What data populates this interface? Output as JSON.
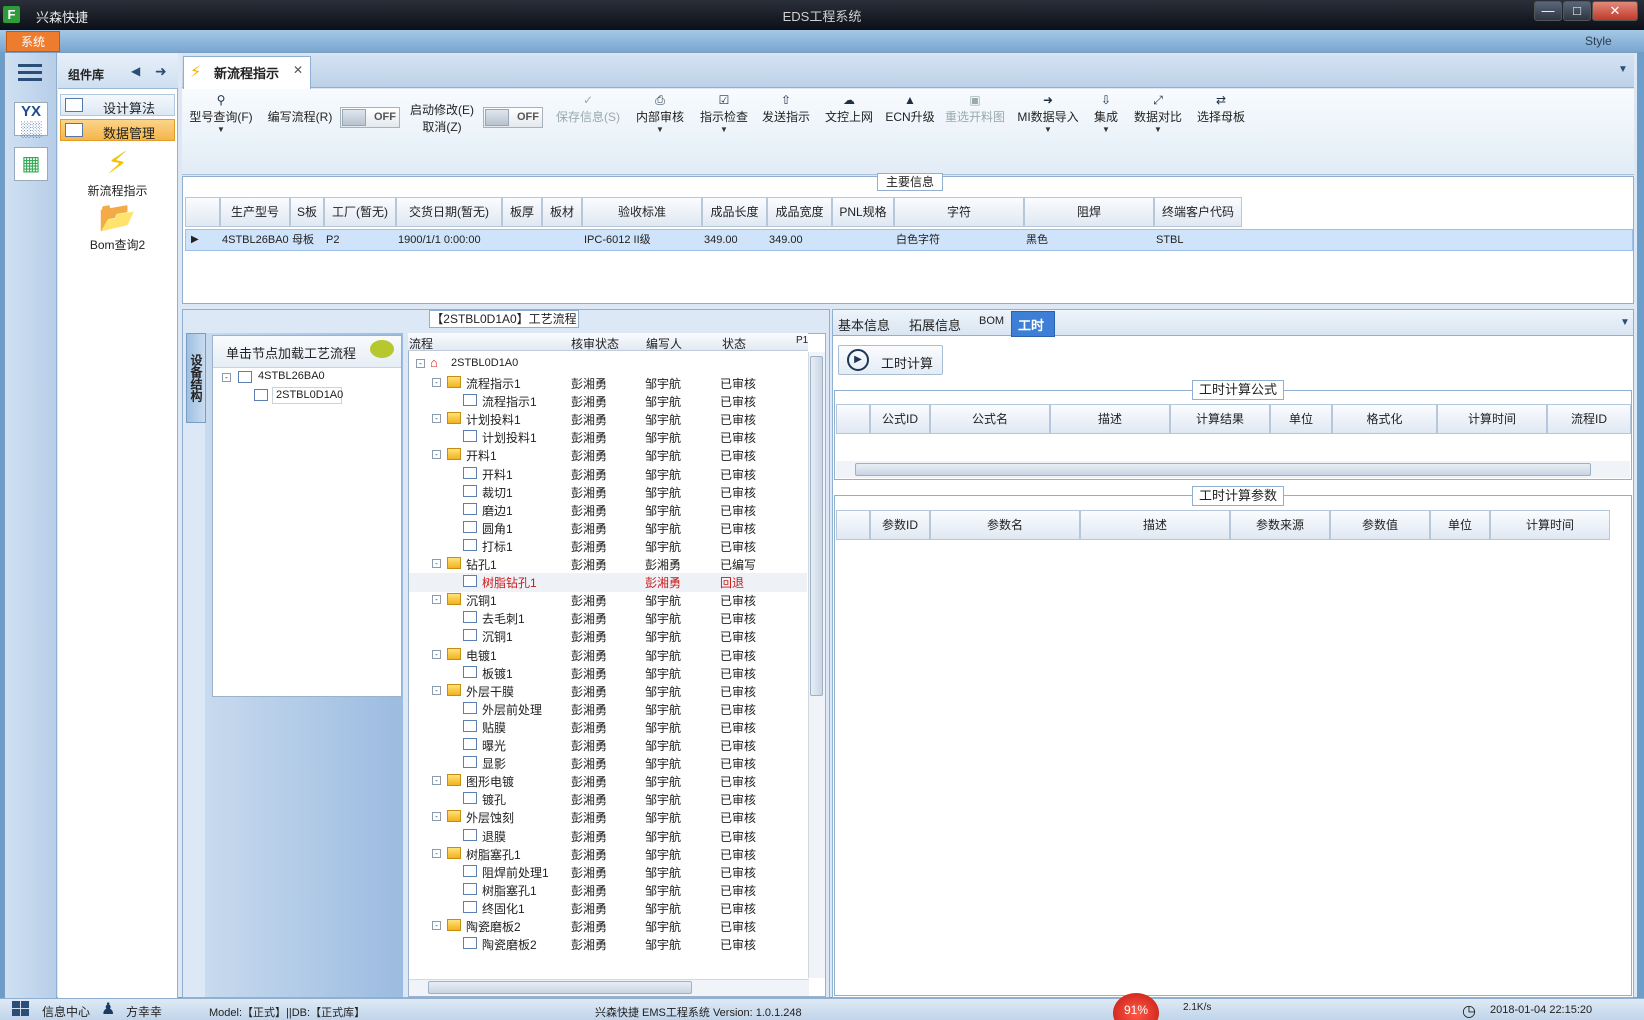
{
  "window": {
    "app_name": "兴森快捷",
    "title": "EDS工程系统",
    "logo": "F",
    "menu_system": "系统",
    "style_label": "Style"
  },
  "library": {
    "title": "组件库",
    "items": [
      "设计算法",
      "数据管理"
    ],
    "tools": [
      {
        "label": "新流程指示",
        "icon": "lightning-icon"
      },
      {
        "label": "Bom查询2",
        "icon": "folder-icon"
      }
    ]
  },
  "tab": {
    "label": "新流程指示"
  },
  "ribbon": {
    "buttons": [
      {
        "label": "型号查询(F)",
        "icon": "search-icon"
      },
      {
        "label": "编写流程(R)",
        "icon": ""
      },
      {
        "label": "启动修改(E)",
        "icon": ""
      },
      {
        "label": "取消(Z)",
        "icon": ""
      },
      {
        "label": "保存信息(S)",
        "icon": "check-icon"
      },
      {
        "label": "内部审核",
        "icon": "print-icon"
      },
      {
        "label": "指示检查",
        "icon": "checkbox-icon"
      },
      {
        "label": "发送指示",
        "icon": "upload-icon"
      },
      {
        "label": "文控上网",
        "icon": "cloud-upload-icon"
      },
      {
        "label": "ECN升级",
        "icon": "road-icon"
      },
      {
        "label": "重选开料图",
        "icon": "image-icon"
      },
      {
        "label": "MI数据导入",
        "icon": "import-icon"
      },
      {
        "label": "集成",
        "icon": "download-icon"
      },
      {
        "label": "数据对比",
        "icon": "compress-icon"
      },
      {
        "label": "选择母板",
        "icon": "shuffle-icon"
      }
    ],
    "toggle_off": "OFF"
  },
  "main_info": {
    "title": "主要信息",
    "columns": [
      "生产型号",
      "S板",
      "工厂(暂无)",
      "交货日期(暂无)",
      "板厚",
      "板材",
      "验收标准",
      "成品长度",
      "成品宽度",
      "PNL规格",
      "字符",
      "阻焊",
      "终端客户代码"
    ],
    "row": [
      "4STBL26BA0",
      "母板",
      "P2",
      "1900/1/1 0:00:00",
      "",
      "",
      "IPC-6012 II级",
      "349.00",
      "349.00",
      "",
      "白色字符",
      "黑色",
      "STBL"
    ]
  },
  "flow": {
    "title": "【2STBL0D1A0】工艺流程",
    "struct_tab": "设备结构",
    "struct_head": "单击节点加载工艺流程",
    "struct_nodes": [
      "4STBL26BA0",
      "2STBL0D1A0"
    ],
    "columns": [
      "流程",
      "核审状态",
      "编写人",
      "状态",
      "P1"
    ],
    "root": "2STBL0D1A0",
    "rows": [
      {
        "name": "流程指示1",
        "type": "folder",
        "reviewer": "彭湘勇",
        "writer": "邹宇航",
        "status": "已审核"
      },
      {
        "name": "流程指示1",
        "type": "doc",
        "reviewer": "彭湘勇",
        "writer": "邹宇航",
        "status": "已审核"
      },
      {
        "name": "计划投料1",
        "type": "folder",
        "reviewer": "彭湘勇",
        "writer": "邹宇航",
        "status": "已审核"
      },
      {
        "name": "计划投料1",
        "type": "doc",
        "reviewer": "彭湘勇",
        "writer": "邹宇航",
        "status": "已审核"
      },
      {
        "name": "开料1",
        "type": "folder",
        "reviewer": "彭湘勇",
        "writer": "邹宇航",
        "status": "已审核"
      },
      {
        "name": "开料1",
        "type": "doc",
        "reviewer": "彭湘勇",
        "writer": "邹宇航",
        "status": "已审核"
      },
      {
        "name": "裁切1",
        "type": "doc",
        "reviewer": "彭湘勇",
        "writer": "邹宇航",
        "status": "已审核"
      },
      {
        "name": "磨边1",
        "type": "doc",
        "reviewer": "彭湘勇",
        "writer": "邹宇航",
        "status": "已审核"
      },
      {
        "name": "圆角1",
        "type": "doc",
        "reviewer": "彭湘勇",
        "writer": "邹宇航",
        "status": "已审核"
      },
      {
        "name": "打标1",
        "type": "doc",
        "reviewer": "彭湘勇",
        "writer": "邹宇航",
        "status": "已审核"
      },
      {
        "name": "钻孔1",
        "type": "folder",
        "reviewer": "彭湘勇",
        "writer": "彭湘勇",
        "status": "已编写"
      },
      {
        "name": "树脂钻孔1",
        "type": "doc",
        "reviewer": "",
        "writer": "彭湘勇",
        "status": "回退",
        "red": true
      },
      {
        "name": "沉铜1",
        "type": "folder",
        "reviewer": "彭湘勇",
        "writer": "邹宇航",
        "status": "已审核"
      },
      {
        "name": "去毛刺1",
        "type": "doc",
        "reviewer": "彭湘勇",
        "writer": "邹宇航",
        "status": "已审核"
      },
      {
        "name": "沉铜1",
        "type": "doc",
        "reviewer": "彭湘勇",
        "writer": "邹宇航",
        "status": "已审核"
      },
      {
        "name": "电镀1",
        "type": "folder",
        "reviewer": "彭湘勇",
        "writer": "邹宇航",
        "status": "已审核"
      },
      {
        "name": "板镀1",
        "type": "doc",
        "reviewer": "彭湘勇",
        "writer": "邹宇航",
        "status": "已审核"
      },
      {
        "name": "外层干膜",
        "type": "folder",
        "reviewer": "彭湘勇",
        "writer": "邹宇航",
        "status": "已审核"
      },
      {
        "name": "外层前处理",
        "type": "doc",
        "reviewer": "彭湘勇",
        "writer": "邹宇航",
        "status": "已审核"
      },
      {
        "name": "贴膜",
        "type": "doc",
        "reviewer": "彭湘勇",
        "writer": "邹宇航",
        "status": "已审核"
      },
      {
        "name": "曝光",
        "type": "doc",
        "reviewer": "彭湘勇",
        "writer": "邹宇航",
        "status": "已审核"
      },
      {
        "name": "显影",
        "type": "doc",
        "reviewer": "彭湘勇",
        "writer": "邹宇航",
        "status": "已审核"
      },
      {
        "name": "图形电镀",
        "type": "folder",
        "reviewer": "彭湘勇",
        "writer": "邹宇航",
        "status": "已审核"
      },
      {
        "name": "镀孔",
        "type": "doc",
        "reviewer": "彭湘勇",
        "writer": "邹宇航",
        "status": "已审核"
      },
      {
        "name": "外层蚀刻",
        "type": "folder",
        "reviewer": "彭湘勇",
        "writer": "邹宇航",
        "status": "已审核"
      },
      {
        "name": "退膜",
        "type": "doc",
        "reviewer": "彭湘勇",
        "writer": "邹宇航",
        "status": "已审核"
      },
      {
        "name": "树脂塞孔1",
        "type": "folder",
        "reviewer": "彭湘勇",
        "writer": "邹宇航",
        "status": "已审核"
      },
      {
        "name": "阻焊前处理1",
        "type": "doc",
        "reviewer": "彭湘勇",
        "writer": "邹宇航",
        "status": "已审核"
      },
      {
        "name": "树脂塞孔1",
        "type": "doc",
        "reviewer": "彭湘勇",
        "writer": "邹宇航",
        "status": "已审核"
      },
      {
        "name": "终固化1",
        "type": "doc",
        "reviewer": "彭湘勇",
        "writer": "邹宇航",
        "status": "已审核"
      },
      {
        "name": "陶瓷磨板2",
        "type": "folder",
        "reviewer": "彭湘勇",
        "writer": "邹宇航",
        "status": "已审核"
      },
      {
        "name": "陶瓷磨板2",
        "type": "doc",
        "reviewer": "彭湘勇",
        "writer": "邹宇航",
        "status": "已审核"
      }
    ]
  },
  "right": {
    "tabs": [
      "基本信息",
      "拓展信息",
      "BOM",
      "工时"
    ],
    "active_tab": "工时",
    "calc_button": "工时计算",
    "formula_title": "工时计算公式",
    "formula_columns": [
      "公式ID",
      "公式名",
      "描述",
      "计算结果",
      "单位",
      "格式化",
      "计算时间",
      "流程ID"
    ],
    "param_title": "工时计算参数",
    "param_columns": [
      "参数ID",
      "参数名",
      "描述",
      "参数来源",
      "参数值",
      "单位",
      "计算时间"
    ]
  },
  "status": {
    "info_center": "信息中心",
    "user": "方幸幸",
    "model": "Model:【正式】||DB:【正式库】",
    "version": "兴森快捷 EMS工程系统 Version: 1.0.1.248",
    "percent": "91%",
    "net": "2.1K/s",
    "datetime": "2018-01-04 22:15:20"
  }
}
